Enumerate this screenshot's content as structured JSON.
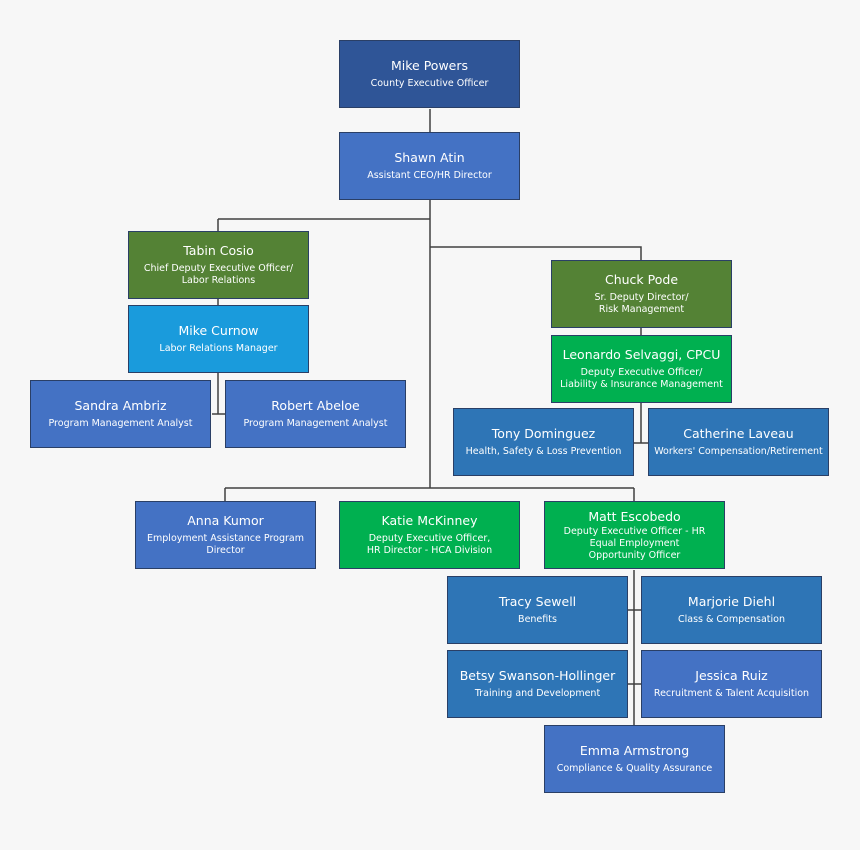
{
  "colors": {
    "dark_blue": "#2f5597",
    "blue": "#4472c4",
    "olive_green": "#548235",
    "light_blue": "#1a9bdc",
    "bright_green": "#00b050",
    "steel_blue": "#2e75b6",
    "connector": "#404040"
  },
  "nodes": {
    "powers": {
      "name": "Mike Powers",
      "title": "County Executive Officer",
      "color": "#2f5597"
    },
    "atin": {
      "name": "Shawn Atin",
      "title": "Assistant CEO/HR Director",
      "color": "#4472c4"
    },
    "cosio": {
      "name": "Tabin Cosio",
      "title": "Chief Deputy Executive Officer/\nLabor Relations",
      "color": "#548235"
    },
    "curnow": {
      "name": "Mike Curnow",
      "title": "Labor Relations Manager",
      "color": "#1a9bdc"
    },
    "ambriz": {
      "name": "Sandra Ambriz",
      "title": "Program Management Analyst",
      "color": "#4472c4"
    },
    "abeloe": {
      "name": "Robert Abeloe",
      "title": "Program Management Analyst",
      "color": "#4472c4"
    },
    "pode": {
      "name": "Chuck Pode",
      "title": "Sr. Deputy Director/\nRisk Management",
      "color": "#548235"
    },
    "selvaggi": {
      "name": "Leonardo Selvaggi, CPCU",
      "title": "Deputy Executive Officer/\nLiability & Insurance Management",
      "color": "#00b050"
    },
    "dominguez": {
      "name": "Tony Dominguez",
      "title": "Health, Safety & Loss Prevention",
      "color": "#2e75b6"
    },
    "laveau": {
      "name": "Catherine Laveau",
      "title": "Workers' Compensation/Retirement",
      "color": "#2e75b6"
    },
    "kumor": {
      "name": "Anna Kumor",
      "title": "Employment Assistance Program\nDirector",
      "color": "#4472c4"
    },
    "mckinney": {
      "name": "Katie McKinney",
      "title": "Deputy Executive Officer,\nHR Director - HCA Division",
      "color": "#00b050"
    },
    "escobedo": {
      "name": "Matt Escobedo",
      "title": "Deputy Executive Officer - HR\nEqual Employment\nOpportunity Officer",
      "color": "#00b050"
    },
    "sewell": {
      "name": "Tracy Sewell",
      "title": "Benefits",
      "color": "#2e75b6"
    },
    "diehl": {
      "name": "Marjorie Diehl",
      "title": "Class & Compensation",
      "color": "#2e75b6"
    },
    "swanson": {
      "name": "Betsy Swanson-Hollinger",
      "title": "Training and Development",
      "color": "#2e75b6"
    },
    "ruiz": {
      "name": "Jessica Ruiz",
      "title": "Recruitment & Talent Acquisition",
      "color": "#4472c4"
    },
    "armstrong": {
      "name": "Emma Armstrong",
      "title": "Compliance & Quality Assurance",
      "color": "#4472c4"
    }
  }
}
